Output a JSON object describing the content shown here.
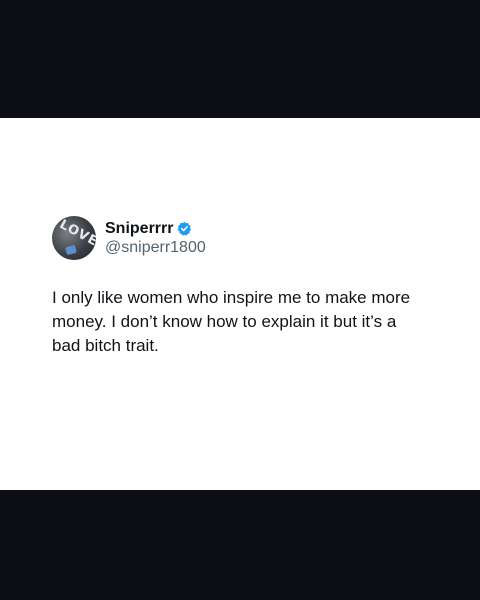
{
  "post": {
    "author": {
      "display_name": "Sniperrrr",
      "handle": "@sniperr1800",
      "verified": true,
      "avatar_text": "LOVE"
    },
    "text": "I only like women who inspire me to make more money. I don’t know how to explain it but it’s a bad bitch trait."
  },
  "colors": {
    "background": "#0c0f14",
    "card": "#ffffff",
    "verified": "#1d9bf0",
    "text_primary": "#0f1419",
    "text_secondary": "#536471"
  }
}
